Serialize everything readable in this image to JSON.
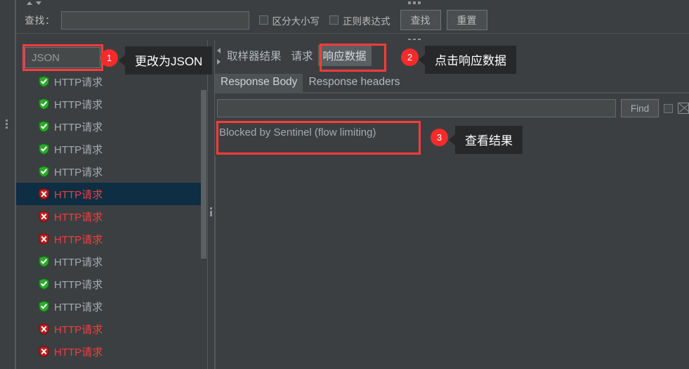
{
  "search_toolbar": {
    "label": "查找：",
    "input_value": "",
    "input_placeholder": "",
    "checkbox_case_label": "区分大小写",
    "checkbox_regex_label": "正则表达式",
    "checkbox_case_checked": false,
    "checkbox_regex_checked": false,
    "find_button": "查找",
    "reset_button": "重置"
  },
  "left_panel": {
    "combo_value": "JSON",
    "tree_items": [
      {
        "label": "HTTP请求",
        "status": "ok",
        "selected": false
      },
      {
        "label": "HTTP请求",
        "status": "ok",
        "selected": false
      },
      {
        "label": "HTTP请求",
        "status": "ok",
        "selected": false
      },
      {
        "label": "HTTP请求",
        "status": "ok",
        "selected": false
      },
      {
        "label": "HTTP请求",
        "status": "ok",
        "selected": false
      },
      {
        "label": "HTTP请求",
        "status": "error",
        "selected": true
      },
      {
        "label": "HTTP请求",
        "status": "error",
        "selected": false
      },
      {
        "label": "HTTP请求",
        "status": "error",
        "selected": false
      },
      {
        "label": "HTTP请求",
        "status": "ok",
        "selected": false
      },
      {
        "label": "HTTP请求",
        "status": "ok",
        "selected": false
      },
      {
        "label": "HTTP请求",
        "status": "ok",
        "selected": false
      },
      {
        "label": "HTTP请求",
        "status": "error",
        "selected": false
      },
      {
        "label": "HTTP请求",
        "status": "error",
        "selected": false
      }
    ]
  },
  "right_panel": {
    "primary_tabs": [
      {
        "label": "取样器结果",
        "active": false
      },
      {
        "label": "请求",
        "active": false
      },
      {
        "label": "响应数据",
        "active": true
      }
    ],
    "secondary_tabs": [
      {
        "label": "Response Body",
        "active": true
      },
      {
        "label": "Response headers",
        "active": false
      }
    ],
    "find_bar": {
      "input_value": "",
      "input_placeholder": "",
      "find_button": "Find",
      "case_checkbox_checked": false,
      "close_icon": "x-box-icon"
    },
    "response_body_text": "Blocked by Sentinel (flow limiting)"
  },
  "annotations": [
    {
      "number": "1",
      "text": "更改为JSON"
    },
    {
      "number": "2",
      "text": "点击响应数据"
    },
    {
      "number": "3",
      "text": "查看结果"
    }
  ],
  "colors": {
    "accent_red": "#ff3b3b",
    "badge_red": "#f42b2b",
    "error_text": "#f03e3e",
    "selection_navy": "#0d2e43",
    "panel_bg": "#3c3f41",
    "callout_bg": "#26282a"
  },
  "icons": {
    "shield_ok": "shield-check-icon",
    "shield_error": "shield-error-icon",
    "scroll_up": "triangle-up-icon",
    "scroll_down": "triangle-down-icon",
    "tab_prev": "triangle-left-icon",
    "tab_next": "triangle-right-icon"
  }
}
